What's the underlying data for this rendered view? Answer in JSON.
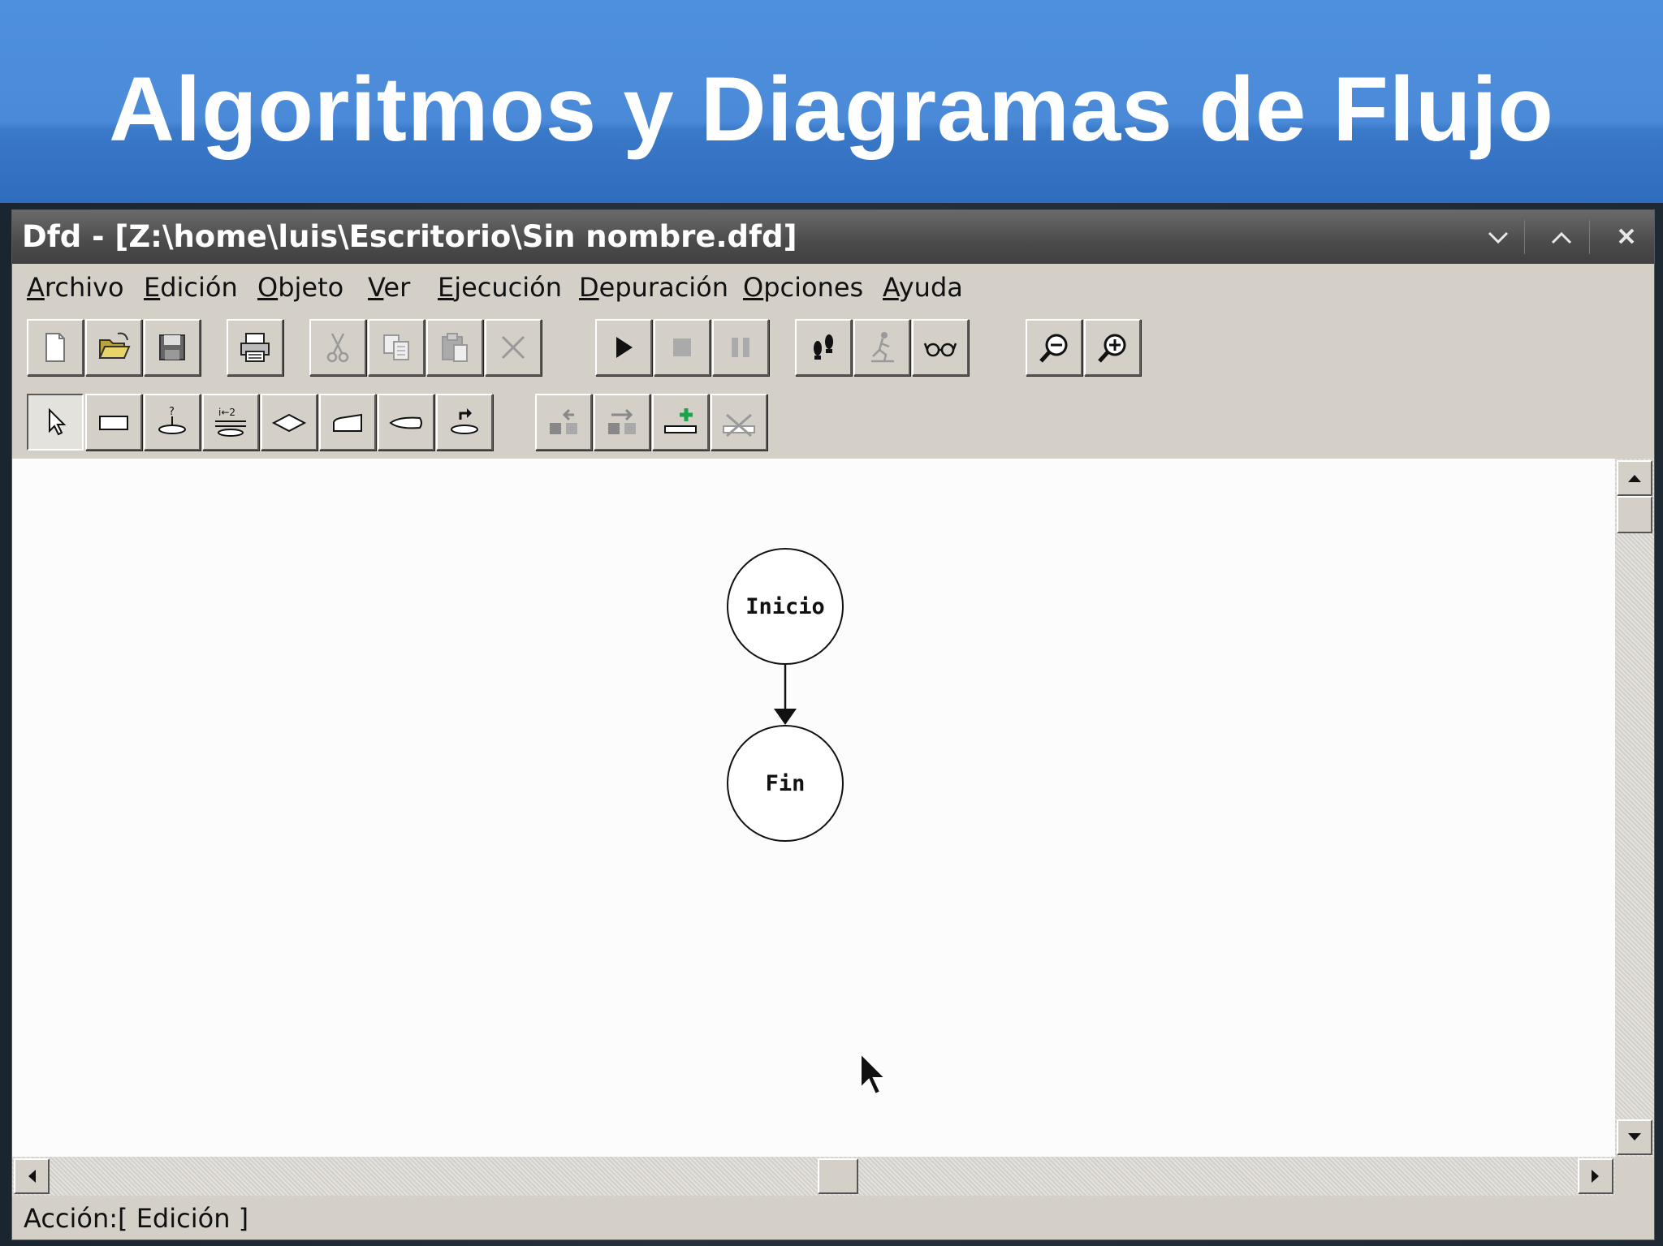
{
  "slide": {
    "title": "Algoritmos y Diagramas de Flujo"
  },
  "window": {
    "title": "Dfd - [Z:\\home\\luis\\Escritorio\\Sin nombre.dfd]",
    "controls": [
      "chevron-down-icon",
      "chevron-up-icon",
      "close-icon"
    ]
  },
  "menu": {
    "items": [
      "Archivo",
      "Edición",
      "Objeto",
      "Ver",
      "Ejecución",
      "Depuración",
      "Opciones",
      "Ayuda"
    ]
  },
  "toolbar1": {
    "buttons": [
      "new-icon",
      "open-icon",
      "save-icon",
      "print-icon",
      "cut-icon",
      "copy-icon",
      "paste-icon",
      "delete-icon",
      "run-icon",
      "stop-icon",
      "pause-icon",
      "step-icon",
      "run-to-icon",
      "watch-icon",
      "zoom-out-icon",
      "zoom-in-icon"
    ]
  },
  "toolbar2": {
    "buttons": [
      "pointer-icon",
      "assignment-icon",
      "read-icon",
      "for-loop-icon",
      "decision-icon",
      "while-loop-icon",
      "output-icon",
      "subprogram-icon",
      "insert-before-icon",
      "insert-after-icon",
      "new-subprogram-icon",
      "delete-subprogram-icon"
    ]
  },
  "flowchart": {
    "nodes": [
      {
        "label": "Inicio"
      },
      {
        "label": "Fin"
      }
    ]
  },
  "status": {
    "text": "Acción:[ Edición ]"
  }
}
